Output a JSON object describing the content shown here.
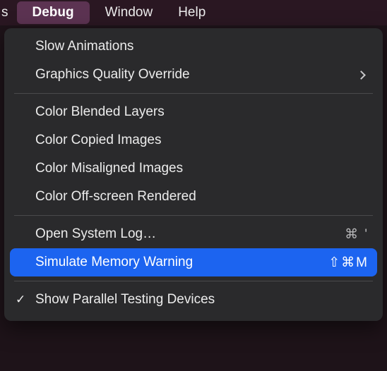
{
  "menubar": {
    "prev_fragment": "s",
    "items": [
      {
        "label": "Debug",
        "active": true
      },
      {
        "label": "Window",
        "active": false
      },
      {
        "label": "Help",
        "active": false
      }
    ]
  },
  "menu": {
    "groups": [
      [
        {
          "label": "Slow Animations",
          "shortcut": "",
          "submenu": false,
          "checked": false
        },
        {
          "label": "Graphics Quality Override",
          "shortcut": "",
          "submenu": true,
          "checked": false
        }
      ],
      [
        {
          "label": "Color Blended Layers",
          "shortcut": "",
          "submenu": false,
          "checked": false
        },
        {
          "label": "Color Copied Images",
          "shortcut": "",
          "submenu": false,
          "checked": false
        },
        {
          "label": "Color Misaligned Images",
          "shortcut": "",
          "submenu": false,
          "checked": false
        },
        {
          "label": "Color Off-screen Rendered",
          "shortcut": "",
          "submenu": false,
          "checked": false
        }
      ],
      [
        {
          "label": "Open System Log…",
          "shortcut": "⌘ '",
          "submenu": false,
          "checked": false
        },
        {
          "label": "Simulate Memory Warning",
          "shortcut": "⇧⌘M",
          "submenu": false,
          "checked": false,
          "highlight": true
        }
      ],
      [
        {
          "label": "Show Parallel Testing Devices",
          "shortcut": "",
          "submenu": false,
          "checked": true
        }
      ]
    ]
  }
}
